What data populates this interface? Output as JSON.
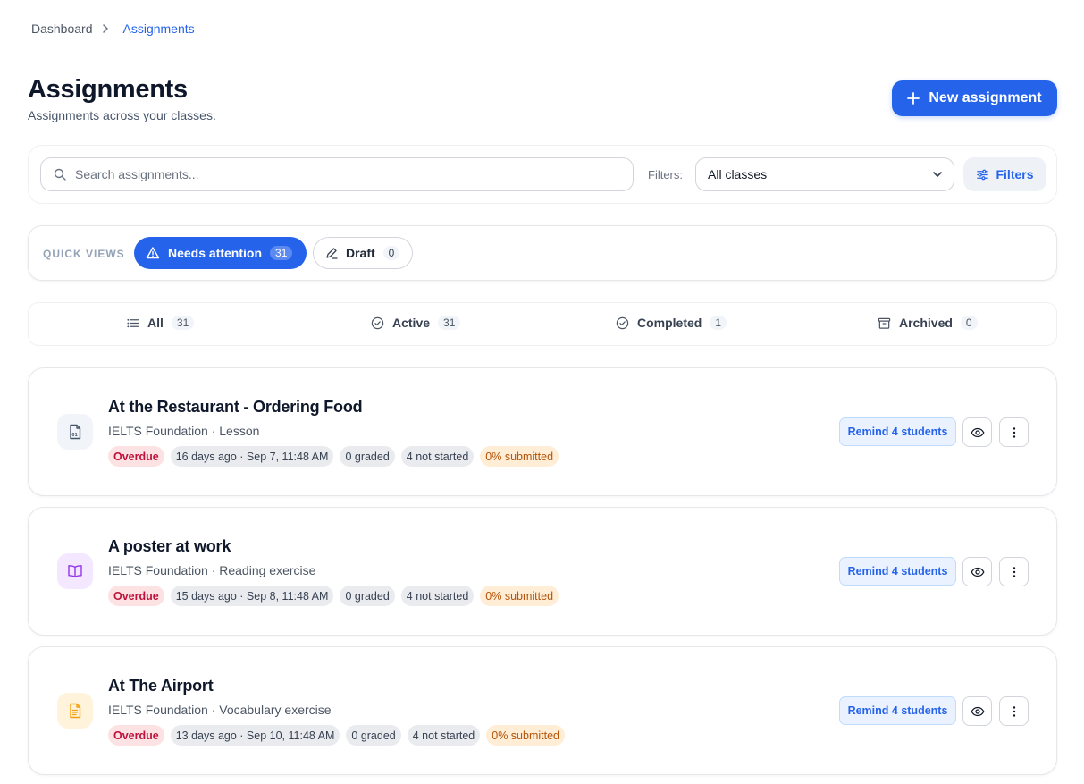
{
  "breadcrumb": {
    "parent": "Dashboard",
    "current": "Assignments"
  },
  "header": {
    "title": "Assignments",
    "subtitle": "Assignments across your classes.",
    "new_button": "New assignment"
  },
  "search": {
    "placeholder": "Search assignments...",
    "value": "",
    "filters_label": "Filters:",
    "class_select": "All classes",
    "filters_button": "Filters"
  },
  "quick_views": {
    "label": "QUICK VIEWS",
    "items": [
      {
        "label": "Needs attention",
        "count": "31",
        "icon": "alert-triangle-icon"
      },
      {
        "label": "Draft",
        "count": "0",
        "icon": "pencil-icon"
      }
    ]
  },
  "tabs": [
    {
      "label": "All",
      "count": "31",
      "icon": "list-icon"
    },
    {
      "label": "Active",
      "count": "31",
      "icon": "check-circle-icon"
    },
    {
      "label": "Completed",
      "count": "1",
      "icon": "check-circle-icon"
    },
    {
      "label": "Archived",
      "count": "0",
      "icon": "archive-icon"
    }
  ],
  "assignments": [
    {
      "title": "At the Restaurant - Ordering Food",
      "meta": "IELTS Foundation · Lesson",
      "icon": "lesson-file-icon",
      "icon_color": "#475569",
      "icon_bg": "#f1f5f9",
      "status": "Overdue",
      "due": "16 days ago · Sep 7, 11:48 AM",
      "graded": "0 graded",
      "not_started": "4 not started",
      "submitted": "0% submitted",
      "remind": "Remind 4 students"
    },
    {
      "title": "A poster at work",
      "meta": "IELTS Foundation · Reading exercise",
      "icon": "book-open-icon",
      "icon_color": "#9333ea",
      "icon_bg": "#f3e8ff",
      "status": "Overdue",
      "due": "15 days ago · Sep 8, 11:48 AM",
      "graded": "0 graded",
      "not_started": "4 not started",
      "submitted": "0% submitted",
      "remind": "Remind 4 students"
    },
    {
      "title": "At The Airport",
      "meta": "IELTS Foundation · Vocabulary exercise",
      "icon": "document-icon",
      "icon_color": "#f59e0b",
      "icon_bg": "#fff3dc",
      "status": "Overdue",
      "due": "13 days ago · Sep 10, 11:48 AM",
      "graded": "0 graded",
      "not_started": "4 not started",
      "submitted": "0% submitted",
      "remind": "Remind 4 students"
    }
  ],
  "colors": {
    "accent": "#2563eb",
    "danger": "#be123c",
    "warning": "#b45309"
  }
}
